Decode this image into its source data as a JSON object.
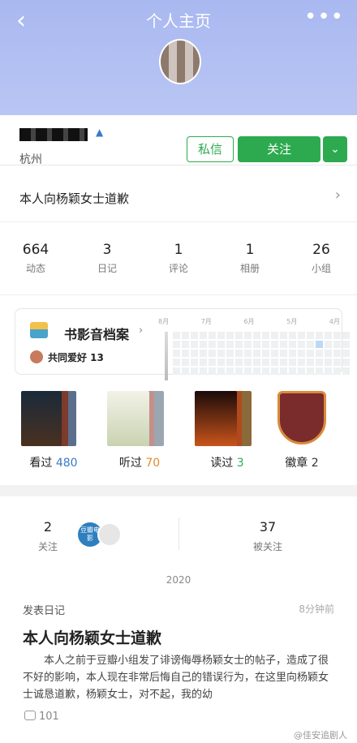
{
  "header": {
    "title": "个人主页",
    "back_icon": "chevron-left-icon",
    "more_icon": "more-icon"
  },
  "profile": {
    "location": "杭州",
    "message_button": "私信",
    "follow_button": "关注",
    "dropdown_icon": "chevron-down-icon"
  },
  "bio": {
    "text": "本人向杨颖女士道歉",
    "chevron": "›"
  },
  "stats": [
    {
      "value": "664",
      "label": "动态"
    },
    {
      "value": "3",
      "label": "日记"
    },
    {
      "value": "1",
      "label": "评论"
    },
    {
      "value": "1",
      "label": "相册"
    },
    {
      "value": "26",
      "label": "小组"
    }
  ],
  "archive": {
    "title": "书影音档案",
    "hobby_label": "共同爱好 13",
    "months": [
      "8月",
      "7月",
      "6月",
      "5月",
      "4月"
    ]
  },
  "media": [
    {
      "verb": "看过",
      "count": "480",
      "count_color": "#3a79c9"
    },
    {
      "verb": "听过",
      "count": "70",
      "count_color": "#e08a2c"
    },
    {
      "verb": "读过",
      "count": "3",
      "count_color": "#2daa4f"
    },
    {
      "verb": "徽章",
      "count": "2",
      "count_color": "#333333"
    }
  ],
  "follow": {
    "following_count": "2",
    "following_label": "关注",
    "followers_count": "37",
    "followers_label": "被关注",
    "avatar_text": "豆瓣电影"
  },
  "timeline": {
    "year": "2020"
  },
  "post": {
    "type": "发表日记",
    "time": "8分钟前",
    "title": "本人向杨颖女士道歉",
    "body": "本人之前于豆瓣小组发了诽谤侮辱杨颖女士的帖子，造成了很不好的影响，本人现在非常后悔自己的错误行为，在这里向杨颖女士诚恳道歉，杨颖女士，对不起，我的幼",
    "comment_count": "101"
  },
  "watermark": "@佳安追剧人",
  "colors": {
    "accent_green": "#2daa4f",
    "header_blue": "#b1bff2"
  }
}
